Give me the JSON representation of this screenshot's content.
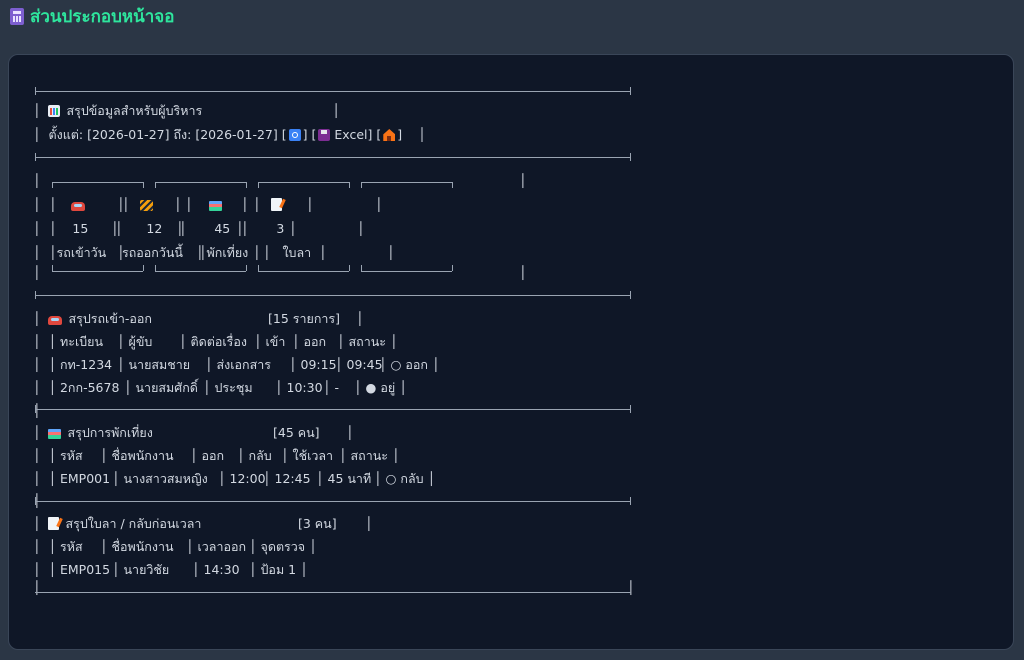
{
  "page": {
    "title": "ส่วนประกอบหน้าจอ",
    "icon": "abacus-icon"
  },
  "report": {
    "title": "สรุปข้อมูลสำหรับผู้บริหาร",
    "range_prefix": "ตั้งแต่:",
    "date_from": "[2026-01-27]",
    "range_mid": "ถึง:",
    "date_to": "[2026-01-27]",
    "excel_label": "Excel",
    "bracket_open": "[",
    "bracket_close": "]"
  },
  "cards": [
    {
      "icon": "car-icon",
      "value": "15",
      "label": "รถเข้าวัน"
    },
    {
      "icon": "construction-icon",
      "value": "12",
      "label": "รถออกวันนี้"
    },
    {
      "icon": "books-icon",
      "value": "45",
      "label": "พักเที่ยง"
    },
    {
      "icon": "memo-icon",
      "value": "3",
      "label": "ใบลา"
    }
  ],
  "vehicles": {
    "title": "สรุปรถเข้า-ออก",
    "count": "[15 รายการ]",
    "headers": [
      "ทะเบียน",
      "ผู้ขับ",
      "ติดต่อเรื่อง",
      "เข้า",
      "ออก",
      "สถานะ"
    ],
    "rows": [
      [
        "กท-1234",
        "นายสมชาย",
        "ส่งเอกสาร",
        "09:15",
        "09:45",
        "○ ออก"
      ],
      [
        "2กก-5678",
        "นายสมศักดิ์",
        "ประชุม",
        "10:30",
        "-",
        "● อยู่"
      ]
    ]
  },
  "lunch": {
    "title": "สรุปการพักเที่ยง",
    "count": "[45 คน]",
    "headers": [
      "รหัส",
      "ชื่อพนักงาน",
      "ออก",
      "กลับ",
      "ใช้เวลา",
      "สถานะ"
    ],
    "rows": [
      [
        "EMP001",
        "นางสาวสมหญิง",
        "12:00",
        "12:45",
        "45 นาที",
        "○ กลับ"
      ]
    ]
  },
  "leave": {
    "title": "สรุปใบลา / กลับก่อนเวลา",
    "count": "[3 คน]",
    "headers": [
      "รหัส",
      "ชื่อพนักงาน",
      "เวลาออก",
      "จุดตรวจ"
    ],
    "rows": [
      [
        "EMP015",
        "นายวิชัย",
        "14:30",
        "ป้อม 1"
      ]
    ]
  },
  "colors": {
    "accent": "#2ee59d",
    "panel": "#0f1727",
    "background": "#2b3645"
  }
}
